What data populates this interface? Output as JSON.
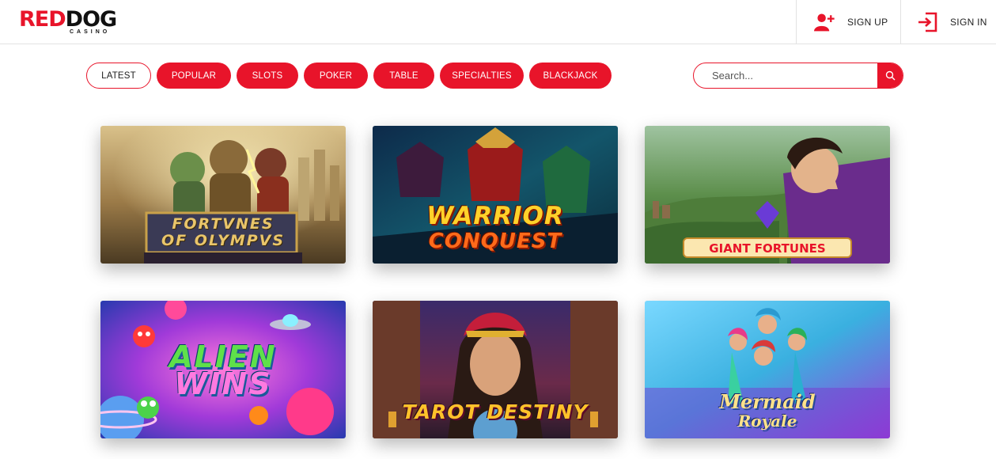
{
  "header": {
    "logo_main_red": "RED",
    "logo_main_dark": "DOG",
    "logo_sub": "CASINO",
    "signup_label": "SIGN UP",
    "signin_label": "SIGN IN",
    "signup_icon": "add-user-icon",
    "signin_icon": "sign-in-icon"
  },
  "categories": [
    {
      "label": "LATEST",
      "active": true
    },
    {
      "label": "POPULAR",
      "active": false
    },
    {
      "label": "SLOTS",
      "active": false
    },
    {
      "label": "POKER",
      "active": false
    },
    {
      "label": "TABLE",
      "active": false
    },
    {
      "label": "SPECIALTIES",
      "active": false
    },
    {
      "label": "BLACKJACK",
      "active": false
    }
  ],
  "search": {
    "placeholder": "Search...",
    "icon": "search-icon"
  },
  "games": [
    {
      "title_line1": "FORTVNES",
      "title_line2": "OF OLYMPVS"
    },
    {
      "title_line1": "WARRIOR",
      "title_line2": "CONQUEST"
    },
    {
      "title_line1": "GIANT FORTUNES",
      "title_line2": ""
    },
    {
      "title_line1": "ALIEN",
      "title_line2": "WINS"
    },
    {
      "title_line1": "TAROT DESTINY",
      "title_line2": ""
    },
    {
      "title_line1": "Mermaid",
      "title_line2": "Royale"
    }
  ],
  "colors": {
    "brand_red": "#e8142a",
    "text_dark": "#222222"
  }
}
